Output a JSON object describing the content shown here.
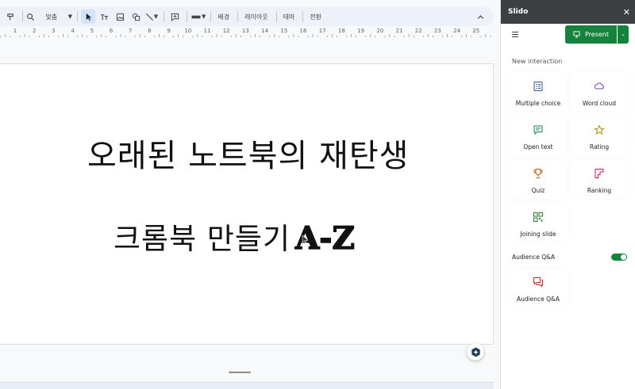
{
  "toolbar": {
    "zoom_value": "맞춤",
    "background_label": "배경",
    "layout_label": "레이아웃",
    "theme_label": "테마",
    "transition_label": "전환"
  },
  "ruler": {
    "numbers": [
      "1",
      "2",
      "3",
      "4",
      "5",
      "6",
      "7",
      "8",
      "9",
      "10",
      "11",
      "12",
      "13",
      "14",
      "15",
      "16",
      "17",
      "18",
      "19",
      "20",
      "21",
      "22",
      "23",
      "24",
      "25"
    ]
  },
  "slide": {
    "title_line1": "오래된 노트북의 재탄생",
    "title_line2": "크롬북 만들기",
    "title_line2_accent": "A-Z"
  },
  "slido": {
    "title": "Slido",
    "present_label": "Present",
    "new_interaction_label": "New interaction",
    "cards": {
      "multiple_choice": "Multiple choice",
      "word_cloud": "Word cloud",
      "open_text": "Open text",
      "rating": "Rating",
      "quiz": "Quiz",
      "ranking": "Ranking",
      "joining_slide": "Joining slide",
      "audience_qa": "Audience Q&A"
    },
    "audience_qa_label": "Audience Q&A",
    "audience_qa_enabled": true
  },
  "colors": {
    "toolbar_bg": "#edf2fa",
    "accent_green": "#16833d",
    "panel_header": "#3c4043"
  }
}
